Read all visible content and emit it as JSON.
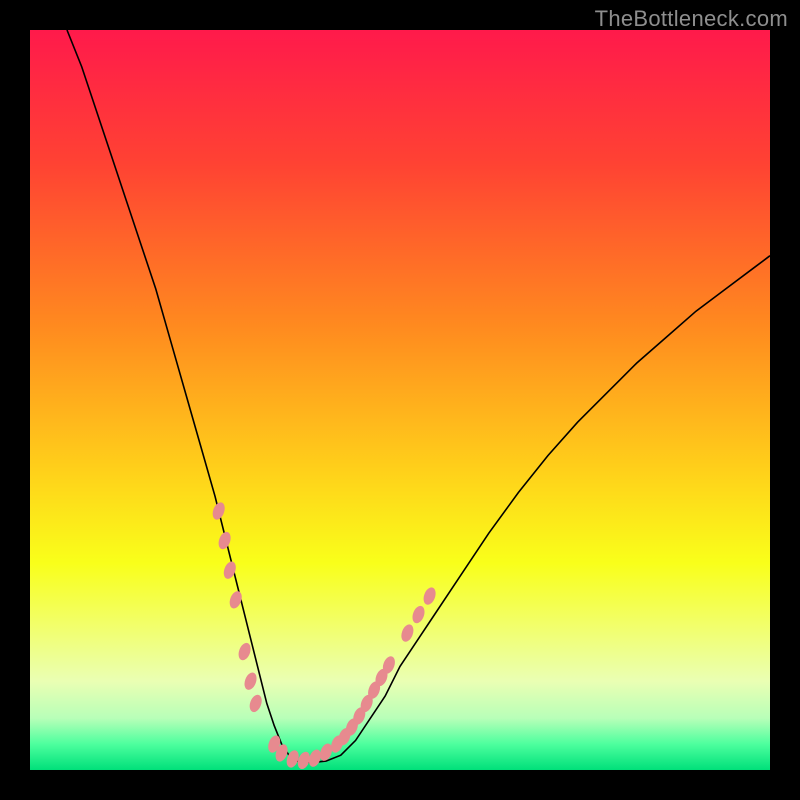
{
  "watermark": "TheBottleneck.com",
  "chart_data": {
    "type": "line",
    "title": "",
    "xlabel": "",
    "ylabel": "",
    "xlim": [
      0,
      100
    ],
    "ylim": [
      0,
      100
    ],
    "grid": false,
    "legend": false,
    "background_gradient_stops": [
      {
        "pos": 0.0,
        "color": "#ff1a4b"
      },
      {
        "pos": 0.18,
        "color": "#ff4233"
      },
      {
        "pos": 0.4,
        "color": "#ff8a1f"
      },
      {
        "pos": 0.6,
        "color": "#ffd21a"
      },
      {
        "pos": 0.72,
        "color": "#f9ff1a"
      },
      {
        "pos": 0.8,
        "color": "#f2ff66"
      },
      {
        "pos": 0.88,
        "color": "#eaffb3"
      },
      {
        "pos": 0.93,
        "color": "#b8ffb8"
      },
      {
        "pos": 0.965,
        "color": "#4dff9e"
      },
      {
        "pos": 1.0,
        "color": "#00e07a"
      }
    ],
    "curve": {
      "name": "bottleneck-curve",
      "color": "#000000",
      "width": 1.6,
      "x": [
        5,
        7,
        9,
        11,
        13,
        15,
        17,
        19,
        21,
        23,
        25,
        26,
        27,
        28,
        29,
        30,
        31,
        32,
        33,
        34,
        35,
        36,
        38,
        40,
        42,
        44,
        46,
        48,
        50,
        54,
        58,
        62,
        66,
        70,
        74,
        78,
        82,
        86,
        90,
        94,
        98,
        100
      ],
      "y": [
        100,
        95,
        89,
        83,
        77,
        71,
        65,
        58,
        51,
        44,
        37,
        33,
        29,
        25,
        21,
        17,
        13,
        9,
        6,
        3.5,
        2,
        1.2,
        1,
        1.2,
        2,
        4,
        7,
        10,
        14,
        20,
        26,
        32,
        37.5,
        42.5,
        47,
        51,
        55,
        58.5,
        62,
        65,
        68,
        69.5
      ]
    },
    "marker_clusters": [
      {
        "name": "left-upper-cluster",
        "x": [
          25.5,
          26.3,
          27.0,
          27.8
        ],
        "y": [
          35,
          31,
          27,
          23
        ]
      },
      {
        "name": "left-lower-cluster",
        "x": [
          29.0,
          29.8,
          30.5
        ],
        "y": [
          16,
          12,
          9
        ]
      },
      {
        "name": "valley-cluster",
        "x": [
          33.0,
          34.0,
          35.5,
          37.0,
          38.5,
          40.0
        ],
        "y": [
          3.5,
          2.3,
          1.5,
          1.3,
          1.6,
          2.4
        ]
      },
      {
        "name": "right-lower-cluster",
        "x": [
          41.5,
          42.5,
          43.5,
          44.5,
          45.5,
          46.5,
          47.5,
          48.5
        ],
        "y": [
          3.5,
          4.5,
          5.8,
          7.3,
          9.0,
          10.8,
          12.5,
          14.2
        ]
      },
      {
        "name": "right-upper-cluster",
        "x": [
          51.0,
          52.5,
          54.0
        ],
        "y": [
          18.5,
          21.0,
          23.5
        ]
      }
    ],
    "marker_style": {
      "color": "#e78a8f",
      "rx": 5.5,
      "ry": 9,
      "rotate_deg": 20
    }
  }
}
